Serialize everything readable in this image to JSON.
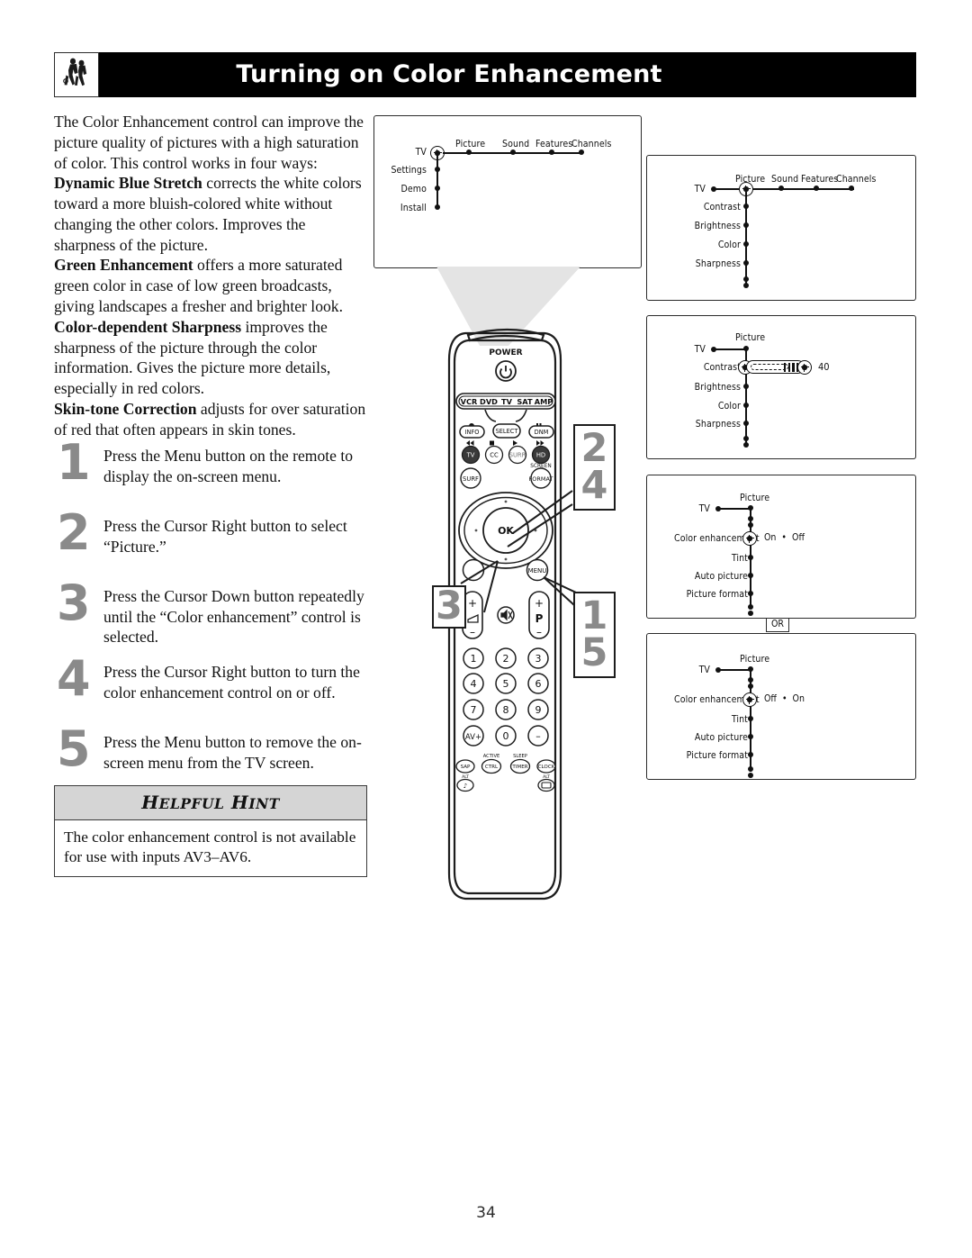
{
  "header": {
    "title": "Turning on Color Enhancement",
    "logo": "two-figures-logo"
  },
  "intro": {
    "p1": "The Color Enhancement control can improve the picture quality of pictures with a high saturation of color. This control works in four ways:",
    "term1": "Dynamic Blue Stretch",
    "p2": " corrects the white colors toward a more bluish-colored white without changing the other colors. Improves the sharpness of the picture.",
    "term2": "Green Enhancement",
    "p3": " offers a more saturated green color in case of low green broadcasts, giving landscapes a fresher and brighter look.",
    "term3": "Color-dependent Sharpness",
    "p4": " improves the sharpness of the picture through the color information. Gives the picture more details, especially in red colors.",
    "term4": "Skin-tone Correction",
    "p5": " adjusts for over saturation of red that often appears in skin tones."
  },
  "steps": [
    {
      "num": "1",
      "text": "Press the Menu button on the remote to display the on-screen menu."
    },
    {
      "num": "2",
      "text": "Press the Cursor Right button to select “Picture.”"
    },
    {
      "num": "3",
      "text": "Press the Cursor Down button repeatedly until the “Color enhancement” control is selected."
    },
    {
      "num": "4",
      "text": "Press the Cursor Right button to turn the color enhancement control on or off."
    },
    {
      "num": "5",
      "text": "Press the Menu button to remove the on-screen menu from the TV screen."
    }
  ],
  "hint": {
    "title_a": "H",
    "title_b": "ELPFUL",
    "title_c": "H",
    "title_d": "INT",
    "body": "The color enhancement control is not available for use with inputs AV3–AV6."
  },
  "screens": {
    "main_menu": {
      "root": "TV",
      "top_items": [
        "Picture",
        "Sound",
        "Features",
        "Channels"
      ],
      "left_items": [
        "Settings",
        "Demo",
        "Install"
      ]
    },
    "picture_menu": {
      "root": "TV",
      "top_items": [
        "Picture",
        "Sound",
        "Features",
        "Channels"
      ],
      "sub_items": [
        "Contrast",
        "Brightness",
        "Color",
        "Sharpness"
      ]
    },
    "contrast_slider": {
      "root": "TV",
      "header": "Picture",
      "sub_items": [
        "Contrast",
        "Brightness",
        "Color",
        "Sharpness"
      ],
      "slider_label": "Contrast",
      "slider_value": "40"
    },
    "color_enh_on": {
      "root": "TV",
      "header": "Picture",
      "selected_label": "Color enhancement",
      "option_left": "On",
      "option_right": "Off",
      "sub_items": [
        "Tint",
        "Auto picture",
        "Picture format"
      ]
    },
    "or_badge": "OR",
    "color_enh_off": {
      "root": "TV",
      "header": "Picture",
      "selected_label": "Color enhancement",
      "option_left": "Off",
      "option_right": "On",
      "sub_items": [
        "Tint",
        "Auto picture",
        "Picture format"
      ]
    }
  },
  "callouts": {
    "top": [
      "2",
      "4"
    ],
    "left": [
      "3"
    ],
    "right": [
      "1",
      "5"
    ]
  },
  "remote": {
    "power_label": "POWER",
    "power_icon": "power-icon",
    "mode_buttons": [
      "VCR",
      "DVD",
      "TV",
      "SAT",
      "AMP"
    ],
    "row_info": [
      "INFO",
      "SELECT",
      "DNM"
    ],
    "row_info_icons": [
      "record-dot-icon",
      "pause-icon"
    ],
    "row_media": [
      "TV",
      "CC",
      "SURR",
      "HD"
    ],
    "row_media_icons": [
      "rewind-icon",
      "stop-icon",
      "play-icon",
      "fast-forward-icon"
    ],
    "surf_label": "SURF",
    "format_label": "FORMAT",
    "format_top_label": "SCREEN",
    "ok_label": "OK",
    "menu_label": "MENU",
    "volume_plus": "+",
    "volume_minus": "–",
    "volume_icon": "volume-icon",
    "mute_icon": "mute-icon",
    "program_plus": "+",
    "program_label": "P",
    "program_minus": "–",
    "keypad": [
      "1",
      "2",
      "3",
      "4",
      "5",
      "6",
      "7",
      "8",
      "9",
      "AV+",
      "0",
      "–"
    ],
    "bottom_row": [
      "SAP",
      "CTRL",
      "TIMER",
      "CLOCK"
    ],
    "bottom_row_top": [
      "",
      "ACTIVE",
      "SLEEP",
      ""
    ],
    "bottom_icons": [
      "alt-music-icon",
      "alt-screen-icon"
    ],
    "bottom_alt_labels": [
      "ALT",
      "ALT"
    ]
  },
  "page": {
    "number": "34"
  },
  "colors": {
    "header_bg": "#000000",
    "header_text": "#ffffff",
    "step_number": "#8a8a8a",
    "hint_header_bg": "#d5d5d5",
    "line": "#111111"
  }
}
